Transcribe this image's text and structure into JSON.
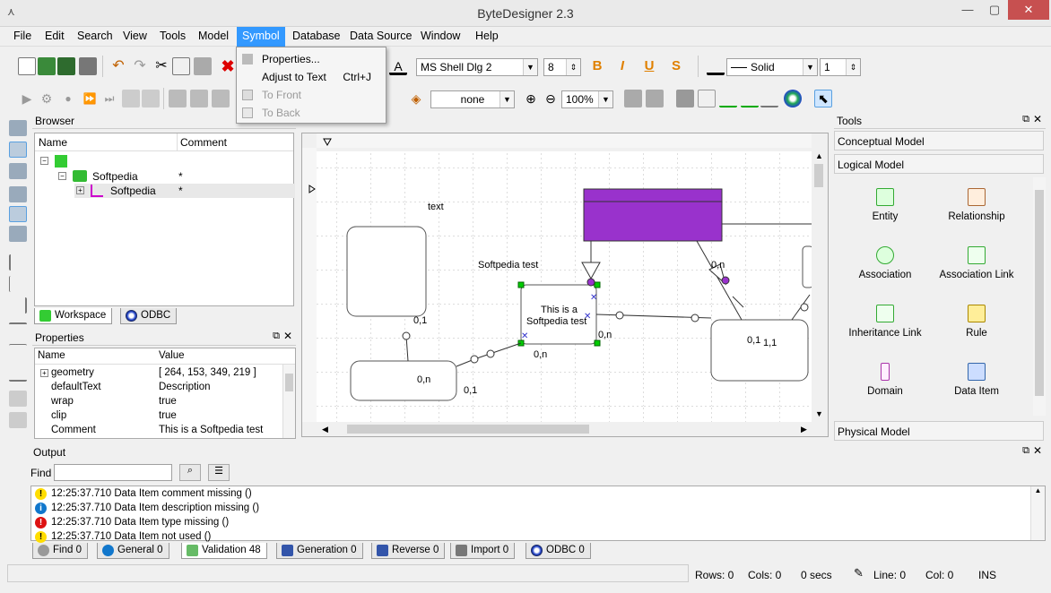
{
  "window": {
    "title": "ByteDesigner 2.3"
  },
  "menu": [
    "File",
    "Edit",
    "Search",
    "View",
    "Tools",
    "Model",
    "Symbol",
    "Database",
    "Data Source",
    "Window",
    "Help"
  ],
  "symbol_menu": {
    "items": [
      {
        "label": "Properties...",
        "shortcut": "",
        "enabled": true
      },
      {
        "label": "Adjust to Text",
        "shortcut": "Ctrl+J",
        "enabled": true
      },
      {
        "label": "To Front",
        "shortcut": "",
        "enabled": false
      },
      {
        "label": "To Back",
        "shortcut": "",
        "enabled": false
      }
    ]
  },
  "toolbar": {
    "font": "MS Shell Dlg 2",
    "font_size": "8",
    "line_style": "Solid",
    "line_width": "1",
    "fill": "none",
    "zoom": "100%"
  },
  "browser": {
    "title": "Browser",
    "col_name": "Name",
    "col_comment": "Comment",
    "rows": [
      {
        "name": "Softpedia",
        "comment": "*"
      },
      {
        "name": "Softpedia",
        "comment": "*"
      }
    ],
    "tabs": [
      "Workspace",
      "ODBC"
    ]
  },
  "properties": {
    "title": "Properties",
    "col_name": "Name",
    "col_value": "Value",
    "rows": [
      {
        "name": "geometry",
        "value": "[ 264, 153, 349, 219 ]"
      },
      {
        "name": "defaultText",
        "value": "Description"
      },
      {
        "name": "wrap",
        "value": "true"
      },
      {
        "name": "clip",
        "value": "true"
      },
      {
        "name": "Comment",
        "value": "This is a Softpedia test"
      }
    ]
  },
  "canvas": {
    "labels": {
      "text": "text",
      "softpedia_test": "Softpedia test",
      "note_line1": "This is a",
      "note_line2": "Softpedia test",
      "c1": "0,1",
      "c2": "0,n",
      "c3": "0,1",
      "c4": "0,n",
      "c5": "0,n",
      "c6": "0,n",
      "c7": "0,1",
      "c8": "1,1"
    }
  },
  "tools": {
    "title": "Tools",
    "conceptual": "Conceptual Model",
    "logical": "Logical Model",
    "physical": "Physical Model",
    "items": [
      "Entity",
      "Relationship",
      "Association",
      "Association Link",
      "Inheritance Link",
      "Rule",
      "Domain",
      "Data Item"
    ]
  },
  "output": {
    "title": "Output",
    "find_label": "Find",
    "lines": [
      {
        "type": "warning",
        "text": "12:25:37.710 Data Item comment missing ()"
      },
      {
        "type": "info",
        "text": "12:25:37.710 Data Item description missing ()"
      },
      {
        "type": "error",
        "text": "12:25:37.710 Data Item type missing ()"
      },
      {
        "type": "warning",
        "text": "12:25:37.710 Data Item not used ()"
      }
    ],
    "tabs": [
      "Find 0",
      "General 0",
      "Validation 48",
      "Generation 0",
      "Reverse 0",
      "Import 0",
      "ODBC 0"
    ]
  },
  "status": {
    "rows": "Rows: 0",
    "cols": "Cols: 0",
    "secs": "0 secs",
    "line": "Line: 0",
    "col": "Col: 0",
    "mode": "INS"
  },
  "colors": {
    "accent": "#3399ff",
    "entity_fill": "#9932cc",
    "handle": "#00c000",
    "close": "#c75050"
  }
}
